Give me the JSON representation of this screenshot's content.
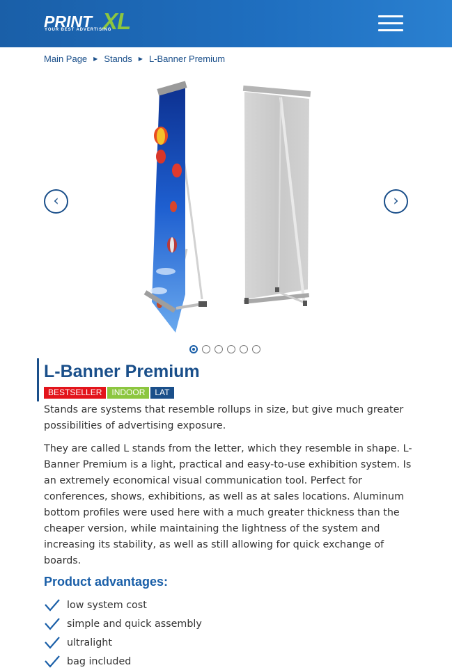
{
  "header": {
    "logo_print": "PRINT",
    "logo_xl": "XL",
    "logo_tagline": "YOUR BEST ADVERTISING",
    "menu_icon": "hamburger-menu-icon",
    "colors": {
      "bar": "#1f6fc0",
      "logo_accent": "#8dc63f"
    }
  },
  "breadcrumb": {
    "items": [
      "Main Page",
      "Stands",
      "L-Banner Premium"
    ],
    "separator_icon": "triangle-right-icon"
  },
  "gallery": {
    "prev_glyph": "‹",
    "next_glyph": "›",
    "slides": 6,
    "active_slide": 1
  },
  "product": {
    "title": "L-Banner Premium",
    "badges": [
      {
        "label": "BESTSELLER",
        "color": "#e3141b"
      },
      {
        "label": "INDOOR",
        "color": "#8cc63f"
      },
      {
        "label": "LAT",
        "color": "#1a4f8a"
      }
    ],
    "description_1": "Stands are systems that resemble rollups in size, but give much greater possibilities of advertising exposure.",
    "description_2": "They are called L stands from the letter, which they resemble in shape. L-Banner Premium is a light, practical and easy-to-use exhibition system. Is an extremely economical visual communication tool. Perfect for conferences, shows, exhibitions, as well as at sales locations. Aluminum bottom profiles were used here with a much greater thickness than the cheaper version, while maintaining the lightness of the system and increasing its stability, as well as still allowing for quick exchange of boards.",
    "advantages_title": "Product advantages:",
    "advantages": [
      "low system cost",
      "simple and quick assembly",
      "ultralight",
      "bag included"
    ]
  }
}
